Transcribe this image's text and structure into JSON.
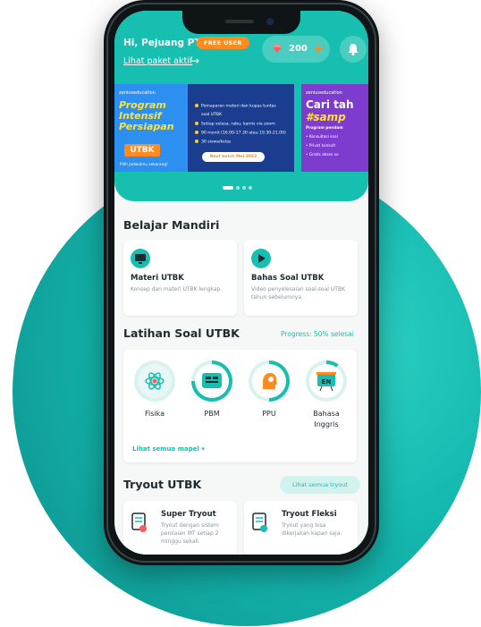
{
  "header": {
    "greeting": "Hi, Pejuang PTN",
    "badge": "FREE USER",
    "paket_link": "Lihat paket aktif",
    "arrow": "→",
    "coins": "200",
    "plus": "+",
    "gem_icon": "diamond-icon",
    "bell_icon": "bell-icon",
    "accent": "#16bfb0",
    "orange": "#ff8a1f"
  },
  "banners": [
    {
      "logo": "zeniuseducation",
      "title_lines": [
        "Program",
        "Intensif",
        "Persiapan"
      ],
      "tag": "UTBK",
      "cta_text": "Pilih jadwalmu sekarang!",
      "features": [
        "Pemaparan materi dan kupas tuntas",
        "soal UTBK",
        "Setiap selasa, rabu, kamis via zoom",
        "90 menit (16.00-17.30 atau 19.30-21.00)",
        "30 siswa/kelas"
      ],
      "next_batch": "Next batch Mei 2022"
    },
    {
      "logo": "zeniuseducation",
      "title": "Cari tah",
      "subtitle": "#samp",
      "lines": [
        "Program pendam",
        "• Konsultasi soal",
        "• Privat konsult",
        "• Gratis akses so"
      ]
    }
  ],
  "belajar": {
    "title": "Belajar Mandiri",
    "cards": [
      {
        "icon": "monitor-icon",
        "title": "Materi UTBK",
        "desc": "Konsep dan materi UTBK lengkap."
      },
      {
        "icon": "play-icon",
        "title": "Bahas Soal UTBK",
        "desc": "Video penyelesaian soal-soal UTBK tahun sebelumnya."
      }
    ]
  },
  "latihan": {
    "title": "Latihan Soal UTBK",
    "progress": "Progress: 50% selesai",
    "subjects": [
      {
        "icon": "atom-icon",
        "label": "Fisika",
        "progress": 0
      },
      {
        "icon": "book-icon",
        "label": "PBM",
        "progress": 0.75
      },
      {
        "icon": "head-icon",
        "label": "PPU",
        "progress": 0.5
      },
      {
        "icon": "en-board-icon",
        "label": "Bahasa Inggris",
        "progress": 0.1
      }
    ],
    "more": "Lihat semua mapel ▾"
  },
  "tryout": {
    "title": "Tryout UTBK",
    "button": "Lihat semua tryout",
    "cards": [
      {
        "icon": "document-clock-icon",
        "title": "Super Tryout",
        "desc": "Tryout dengan sistem penilaian IRT setiap 2 minggu sekali."
      },
      {
        "icon": "document-check-icon",
        "title": "Tryout Fleksi",
        "desc": "Tryout yang bisa dikerjakan kapan saja."
      }
    ]
  }
}
